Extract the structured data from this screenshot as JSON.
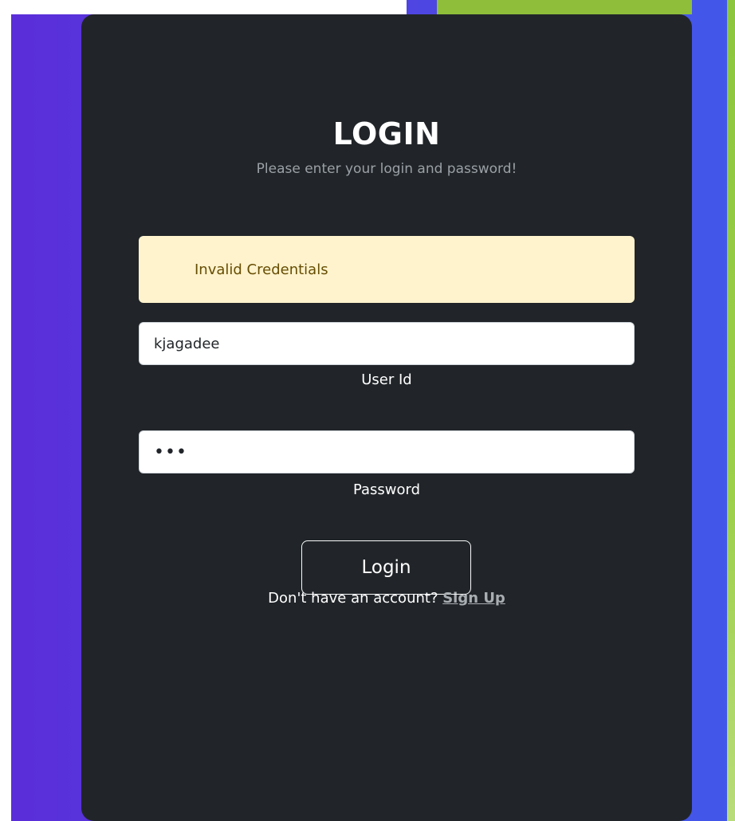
{
  "login": {
    "title": "LOGIN",
    "subtitle": "Please enter your login and password!",
    "alert": "Invalid Credentials",
    "user_id_value": "kjagadee",
    "user_id_label": "User Id",
    "password_value": "abc",
    "password_label": "Password",
    "login_button": "Login",
    "signup_prompt": "Don't have an account? ",
    "signup_link": "Sign Up"
  },
  "colors": {
    "card_bg": "#212529",
    "alert_bg": "#fff3cd",
    "alert_text": "#664d03",
    "background_purple": "#5a2ed9",
    "background_blue": "#4158ea",
    "accent_green": "#8cc63e"
  }
}
